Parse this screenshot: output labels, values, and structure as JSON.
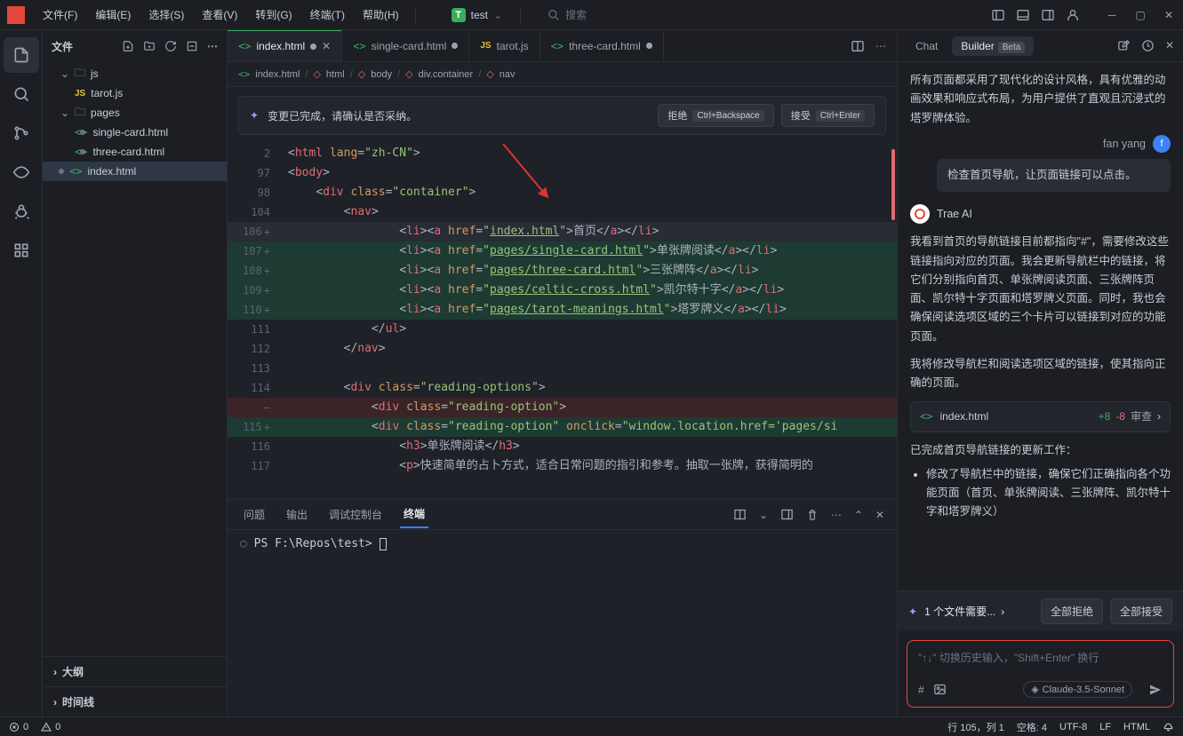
{
  "menu": {
    "file": "文件(F)",
    "edit": "编辑(E)",
    "select": "选择(S)",
    "view": "查看(V)",
    "goto": "转到(G)",
    "terminal": "终端(T)",
    "help": "帮助(H)"
  },
  "project": {
    "letter": "T",
    "name": "test"
  },
  "search": {
    "placeholder": "搜索"
  },
  "sidebar": {
    "title": "文件",
    "tree": {
      "js": "js",
      "tarot": "tarot.js",
      "pages": "pages",
      "single": "single-card.html",
      "three": "three-card.html",
      "index": "index.html"
    },
    "outline": "大纲",
    "timeline": "时间线"
  },
  "tabs": {
    "index": "index.html",
    "single": "single-card.html",
    "tarot": "tarot.js",
    "three": "three-card.html"
  },
  "breadcrumb": {
    "file": "index.html",
    "html": "html",
    "body": "body",
    "container": "div.container",
    "nav": "nav"
  },
  "banner": {
    "text": "变更已完成，请确认是否采纳。",
    "reject": "拒绝",
    "reject_kbd": "Ctrl+Backspace",
    "accept": "接受",
    "accept_kbd": "Ctrl+Enter"
  },
  "code": {
    "l2": "<html lang=\"zh-CN\">",
    "l97": "<body>",
    "l98": "    <div class=\"container\">",
    "l104": "        <nav>",
    "l106": "                <li><a href=\"index.html\">首页</a></li>",
    "l107": "                <li><a href=\"pages/single-card.html\">单张牌阅读</a></li>",
    "l108": "                <li><a href=\"pages/three-card.html\">三张牌阵</a></li>",
    "l109": "                <li><a href=\"pages/celtic-cross.html\">凯尔特十字</a></li>",
    "l110": "                <li><a href=\"pages/tarot-meanings.html\">塔罗牌义</a></li>",
    "l111": "            </ul>",
    "l112": "        </nav>",
    "l113": "",
    "l114": "        <div class=\"reading-options\">",
    "ldel": "            <div class=\"reading-option\">",
    "l115": "            <div class=\"reading-option\" onclick=\"window.location.href='pages/si",
    "l116": "                <h3>单张牌阅读</h3>",
    "l117": "                <p>快速简单的占卜方式，适合日常问题的指引和参考。抽取一张牌，获得简明的",
    "nums": {
      "n2": "2",
      "n97": "97",
      "n98": "98",
      "n104": "104",
      "n106": "106",
      "n107": "107",
      "n108": "108",
      "n109": "109",
      "n110": "110",
      "n111": "111",
      "n112": "112",
      "n113": "113",
      "n114": "114",
      "ndel": "—",
      "n115": "115",
      "n116": "116",
      "n117": "117"
    }
  },
  "links": {
    "index": "index.html",
    "single": "pages/single-card.html",
    "three": "pages/three-card.html",
    "celtic": "pages/celtic-cross.html",
    "meanings": "pages/tarot-meanings.html"
  },
  "nav_text": {
    "home": "首页",
    "single": "单张牌阅读",
    "three": "三张牌阵",
    "celtic": "凯尔特十字",
    "meanings": "塔罗牌义"
  },
  "terminal": {
    "tabs": {
      "problems": "问题",
      "output": "输出",
      "debug": "调试控制台",
      "terminal": "终端"
    },
    "prompt": "PS F:\\Repos\\test> "
  },
  "ai": {
    "tab_chat": "Chat",
    "tab_builder": "Builder",
    "badge": "Beta",
    "intro": "所有页面都采用了现代化的设计风格，具有优雅的动画效果和响应式布局，为用户提供了直观且沉浸式的塔罗牌体验。",
    "user_name": "fan yang",
    "user_initial": "f",
    "user_msg": "检查首页导航，让页面链接可以点击。",
    "ai_name": "Trae AI",
    "ai_p1": "我看到首页的导航链接目前都指向\"#\"，需要修改这些链接指向对应的页面。我会更新导航栏中的链接，将它们分别指向首页、单张牌阅读页面、三张牌阵页面、凯尔特十字页面和塔罗牌义页面。同时，我也会确保阅读选项区域的三个卡片可以链接到对应的功能页面。",
    "ai_p2": "我将修改导航栏和阅读选项区域的链接，使其指向正确的页面。",
    "file": "index.html",
    "file_plus": "+8",
    "file_minus": "-8",
    "review": "审查",
    "done": "已完成首页导航链接的更新工作：",
    "li1": "修改了导航栏中的链接，确保它们正确指向各个功能页面（首页、单张牌阅读、三张牌阵、凯尔特十字和塔罗牌义）",
    "pending": "1 个文件需要...",
    "reject_all": "全部拒绝",
    "accept_all": "全部接受",
    "input_ph": "\"↑↓\" 切换历史输入，\"Shift+Enter\" 换行",
    "model": "Claude-3.5-Sonnet"
  },
  "status": {
    "err": "0",
    "warn": "0",
    "pos": "行 105，列 1",
    "spaces": "空格: 4",
    "enc": "UTF-8",
    "eol": "LF",
    "lang": "HTML"
  }
}
